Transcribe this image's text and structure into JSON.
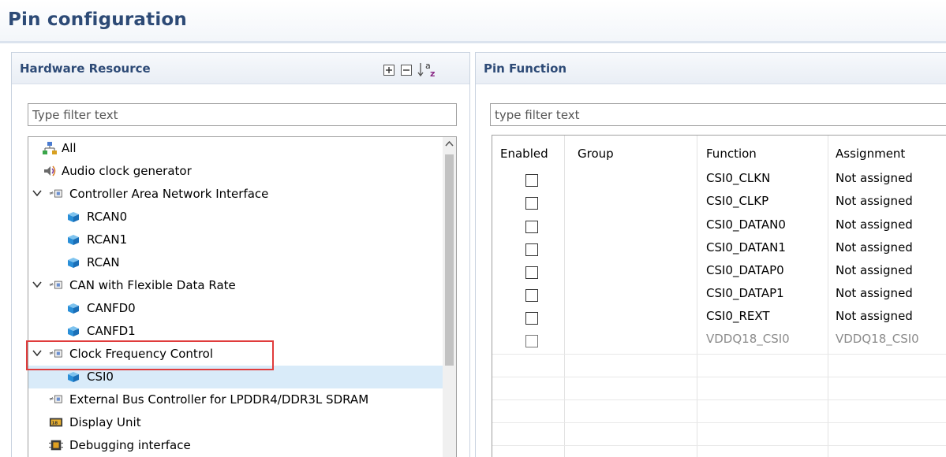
{
  "page": {
    "title": "Pin configuration"
  },
  "hardware_resource": {
    "title": "Hardware Resource",
    "toolbar": {
      "expand_all": "expand-all-icon",
      "collapse_all": "collapse-all-icon",
      "sort": "sort-az-icon"
    },
    "filter": {
      "placeholder": "Type filter text",
      "value": ""
    },
    "tree": [
      {
        "label": "All",
        "icon": "network-icon",
        "level": 0,
        "expandable": false
      },
      {
        "label": "Audio clock generator",
        "icon": "speaker-icon",
        "level": 0,
        "expandable": false
      },
      {
        "label": "Controller Area Network Interface",
        "icon": "chip-icon",
        "level": 0,
        "expandable": true,
        "expanded": true
      },
      {
        "label": "RCAN0",
        "icon": "cube-icon",
        "level": 1
      },
      {
        "label": "RCAN1",
        "icon": "cube-icon",
        "level": 1
      },
      {
        "label": "RCAN",
        "icon": "cube-icon",
        "level": 1
      },
      {
        "label": "CAN with Flexible Data Rate",
        "icon": "chip-icon",
        "level": 0,
        "expandable": true,
        "expanded": true
      },
      {
        "label": "CANFD0",
        "icon": "cube-icon",
        "level": 1
      },
      {
        "label": "CANFD1",
        "icon": "cube-icon",
        "level": 1
      },
      {
        "label": "Clock Frequency Control",
        "icon": "chip-icon",
        "level": 0,
        "expandable": true,
        "expanded": true,
        "highlighted": true
      },
      {
        "label": "CSI0",
        "icon": "cube-icon",
        "level": 1,
        "selected": true
      },
      {
        "label": "External Bus Controller for LPDDR4/DDR3L SDRAM",
        "icon": "chip-icon",
        "level": 0,
        "expandable": false
      },
      {
        "label": "Display Unit",
        "icon": "display-icon",
        "level": 0,
        "expandable": false
      },
      {
        "label": "Debugging interface",
        "icon": "debug-icon",
        "level": 0,
        "expandable": false
      }
    ]
  },
  "pin_function": {
    "title": "Pin Function",
    "filter": {
      "placeholder": "type filter text",
      "value": ""
    },
    "columns": [
      "Enabled",
      "Group",
      "Function",
      "Assignment"
    ],
    "rows": [
      {
        "enabled": false,
        "group": "",
        "function": "CSI0_CLKN",
        "assignment": "Not assigned",
        "disabled": false
      },
      {
        "enabled": false,
        "group": "",
        "function": "CSI0_CLKP",
        "assignment": "Not assigned",
        "disabled": false
      },
      {
        "enabled": false,
        "group": "",
        "function": "CSI0_DATAN0",
        "assignment": "Not assigned",
        "disabled": false
      },
      {
        "enabled": false,
        "group": "",
        "function": "CSI0_DATAN1",
        "assignment": "Not assigned",
        "disabled": false
      },
      {
        "enabled": false,
        "group": "",
        "function": "CSI0_DATAP0",
        "assignment": "Not assigned",
        "disabled": false
      },
      {
        "enabled": false,
        "group": "",
        "function": "CSI0_DATAP1",
        "assignment": "Not assigned",
        "disabled": false
      },
      {
        "enabled": false,
        "group": "",
        "function": "CSI0_REXT",
        "assignment": "Not assigned",
        "disabled": false
      },
      {
        "enabled": false,
        "group": "",
        "function": "VDDQ18_CSI0",
        "assignment": "VDDQ18_CSI0",
        "disabled": true
      }
    ]
  },
  "colors": {
    "header_text": "#2d4a76",
    "selection": "#d9ebf9",
    "highlight_border": "#e03c3c",
    "disabled_text": "#8c8c8c"
  }
}
